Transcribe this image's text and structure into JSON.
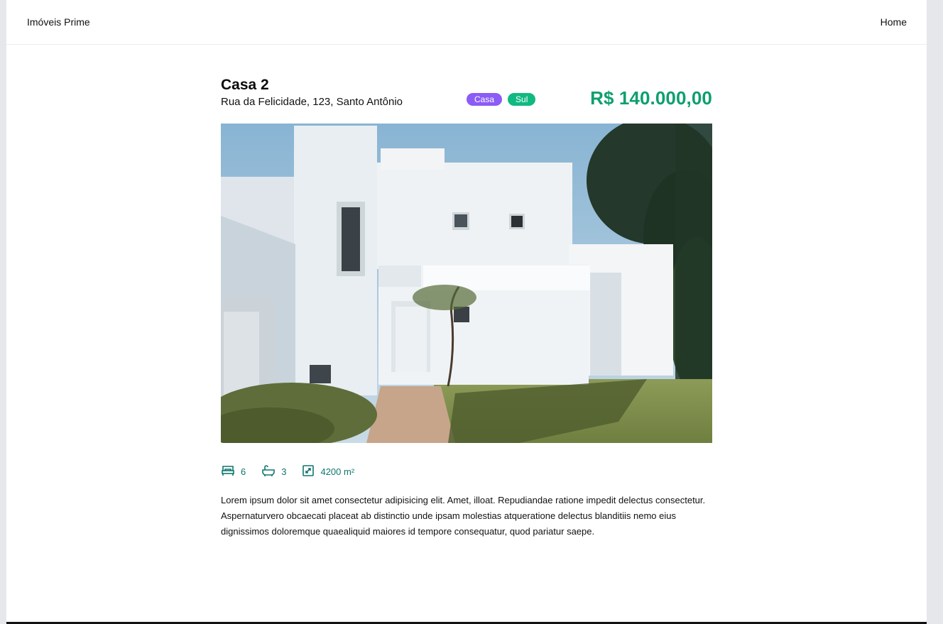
{
  "navbar": {
    "brand": "Imóveis Prime",
    "home_link": "Home"
  },
  "property": {
    "title": "Casa 2",
    "address": "Rua da Felicidade, 123, Santo Antônio",
    "badges": {
      "type": "Casa",
      "region": "Sul"
    },
    "price": "R$ 140.000,00",
    "features": {
      "bedrooms": "6",
      "bathrooms": "3",
      "area": "4200 m²"
    },
    "description": "Lorem ipsum dolor sit amet consectetur adipisicing elit. Amet, illoat. Repudiandae ratione impedit delectus consectetur. Aspernaturvero obcaecati placeat ab distinctio unde ipsam molestias atqueratione delectus blanditiis nemo eius dignissimos doloremque quaealiquid maiores id tempore consequatur, quod pariatur saepe."
  },
  "colors": {
    "price": "#0e9f6e",
    "badge_type": "#8b5cf6",
    "badge_region": "#10b981",
    "feature_icons": "#0f766e"
  },
  "icons": [
    "bed-icon",
    "bathtub-icon",
    "area-icon"
  ]
}
